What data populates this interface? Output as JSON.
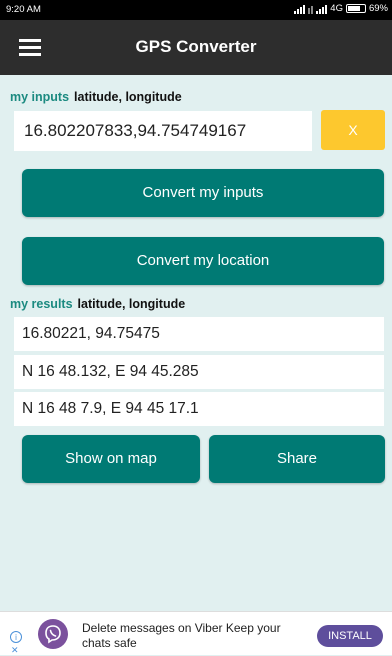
{
  "status_bar": {
    "time": "9:20 AM",
    "network": "4G",
    "battery": "69%"
  },
  "app_bar": {
    "title": "GPS Converter",
    "menu_icon": "hamburger-menu-icon"
  },
  "inputs": {
    "label_accent": "my inputs",
    "label": "latitude, longitude",
    "value": "16.802207833,94.754749167",
    "clear_label": "X",
    "clear_color": "#fdc82e"
  },
  "actions": {
    "convert_inputs": "Convert my inputs",
    "convert_location": "Convert my location",
    "button_color": "#007a74"
  },
  "results": {
    "label_accent": "my results",
    "label": "latitude, longitude",
    "rows": [
      "16.80221, 94.75475",
      "N 16 48.132, E 94 45.285",
      "N 16 48 7.9, E 94 45 17.1"
    ]
  },
  "result_actions": {
    "show_on_map": "Show on map",
    "share": "Share"
  },
  "ad": {
    "text": "Delete messages on Viber Keep your chats safe",
    "install": "INSTALL",
    "app_icon": "viber-icon"
  }
}
